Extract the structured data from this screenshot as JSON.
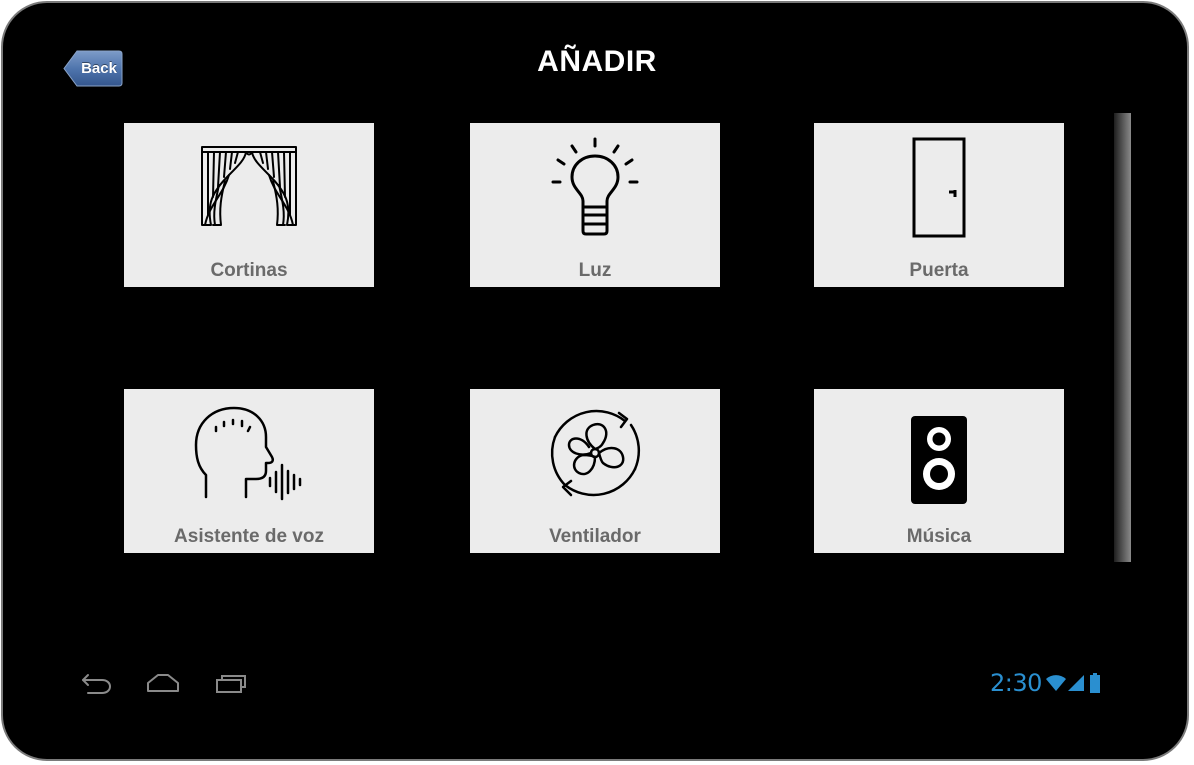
{
  "header": {
    "back_label": "Back",
    "title": "AÑADIR"
  },
  "tiles": [
    {
      "label": "Cortinas",
      "icon": "curtains-icon"
    },
    {
      "label": "Luz",
      "icon": "lightbulb-icon"
    },
    {
      "label": "Puerta",
      "icon": "door-icon"
    },
    {
      "label": "Asistente de voz",
      "icon": "voice-assistant-icon"
    },
    {
      "label": "Ventilador",
      "icon": "fan-icon"
    },
    {
      "label": "Música",
      "icon": "speaker-icon"
    }
  ],
  "navbar": {
    "buttons": [
      "back-nav-icon",
      "home-nav-icon",
      "recent-apps-icon"
    ]
  },
  "status_bar": {
    "time": "2:30",
    "icons": [
      "wifi-icon",
      "signal-icon",
      "battery-icon"
    ],
    "accent_color": "#2a8fd0"
  },
  "colors": {
    "background": "#000000",
    "tile_background": "#ececec",
    "tile_label": "#6a6a6a",
    "back_button": "#3f6aa8"
  }
}
